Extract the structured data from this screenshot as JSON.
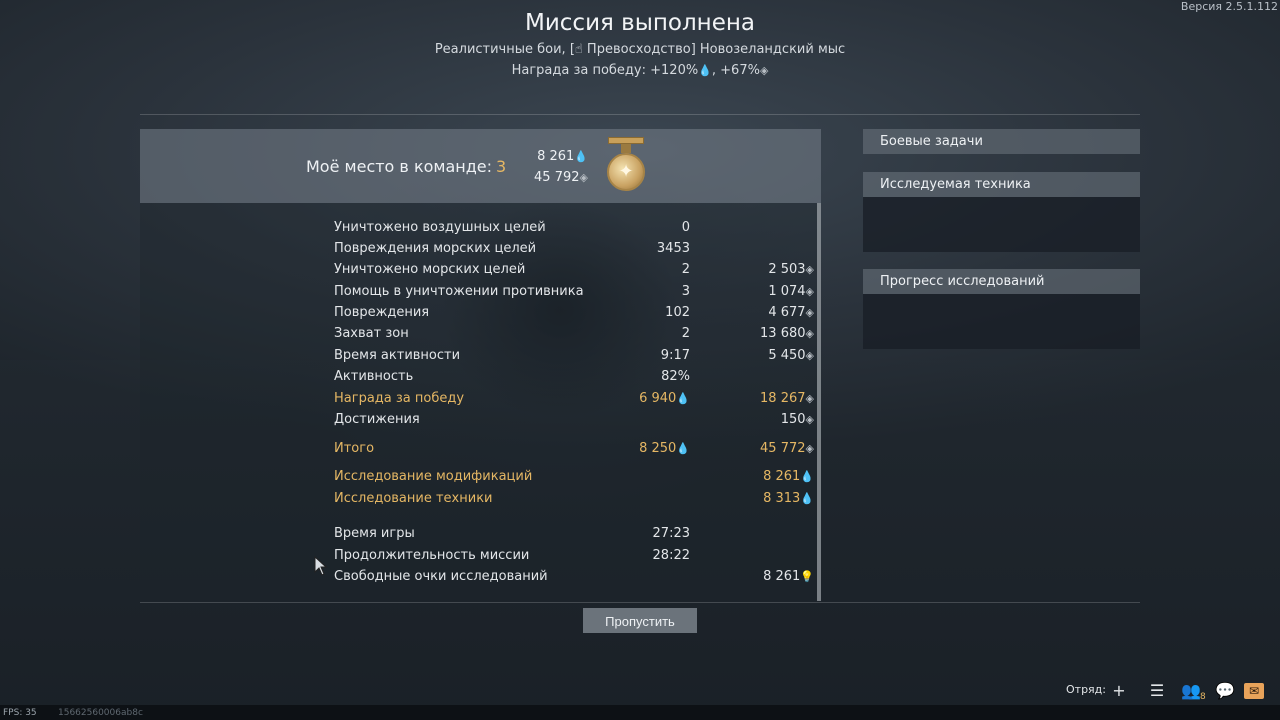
{
  "version": "Версия 2.5.1.112",
  "title": "Миссия выполнена",
  "subtitle": "Реалистичные бои, [☝ Превосходство] Новозеландский мыс",
  "reward_line": {
    "prefix": "Награда за победу: +120%",
    "middle": ", +67%"
  },
  "team_place": {
    "label": "Моё место в команде:",
    "value": "3",
    "rp": "8 261",
    "sl": "45 792"
  },
  "stats": [
    {
      "label": "Уничтожено воздушных целей",
      "v1": "0",
      "v2": "",
      "gold": false
    },
    {
      "label": "Повреждения морских целей",
      "v1": "3453",
      "v2": "",
      "gold": false
    },
    {
      "label": "Уничтожено морских целей",
      "v1": "2",
      "v2": "2 503",
      "gold": false
    },
    {
      "label": "Помощь в уничтожении противника",
      "v1": "3",
      "v2": "1 074",
      "gold": false
    },
    {
      "label": "Повреждения",
      "v1": "102",
      "v2": "4 677",
      "gold": false
    },
    {
      "label": "Захват зон",
      "v1": "2",
      "v2": "13 680",
      "gold": false
    },
    {
      "label": "Время активности",
      "v1": "9:17",
      "v2": "5 450",
      "gold": false
    },
    {
      "label": "Активность",
      "v1": "82%",
      "v2": "",
      "gold": false
    },
    {
      "label": "Награда за победу",
      "v1": "6 940",
      "v2": "18 267",
      "gold": true
    },
    {
      "label": "Достижения",
      "v1": "",
      "v2": "150",
      "gold": false
    },
    {
      "label": "Итого",
      "v1": "8 250",
      "v2": "45 772",
      "gold": true
    },
    {
      "label": "Исследование модификаций",
      "v1": "",
      "v2": "8 261",
      "gold": true
    },
    {
      "label": "Исследование техники",
      "v1": "",
      "v2": "8 313",
      "gold": true
    },
    {
      "label": "Время игры",
      "v1": "27:23",
      "v2": "",
      "gold": false
    },
    {
      "label": "Продолжительность миссии",
      "v1": "28:22",
      "v2": "",
      "gold": false
    },
    {
      "label": "Свободные очки исследований",
      "v1": "",
      "v2": "8 261",
      "gold": false
    }
  ],
  "skip_button": "Пропустить",
  "side": {
    "combat_tasks": "Боевые задачи",
    "researched_vehicle": "Исследуемая техника",
    "research_progress": "Прогресс исследований"
  },
  "bottom": {
    "fps": "FPS: 35",
    "hash": "15662560006ab8c",
    "squad_label": "Отряд:",
    "friends_count": "8"
  },
  "colors": {
    "gold": "#e5b764",
    "rp_blue": "#6f9be0",
    "free_rp": "#e7f07a"
  }
}
